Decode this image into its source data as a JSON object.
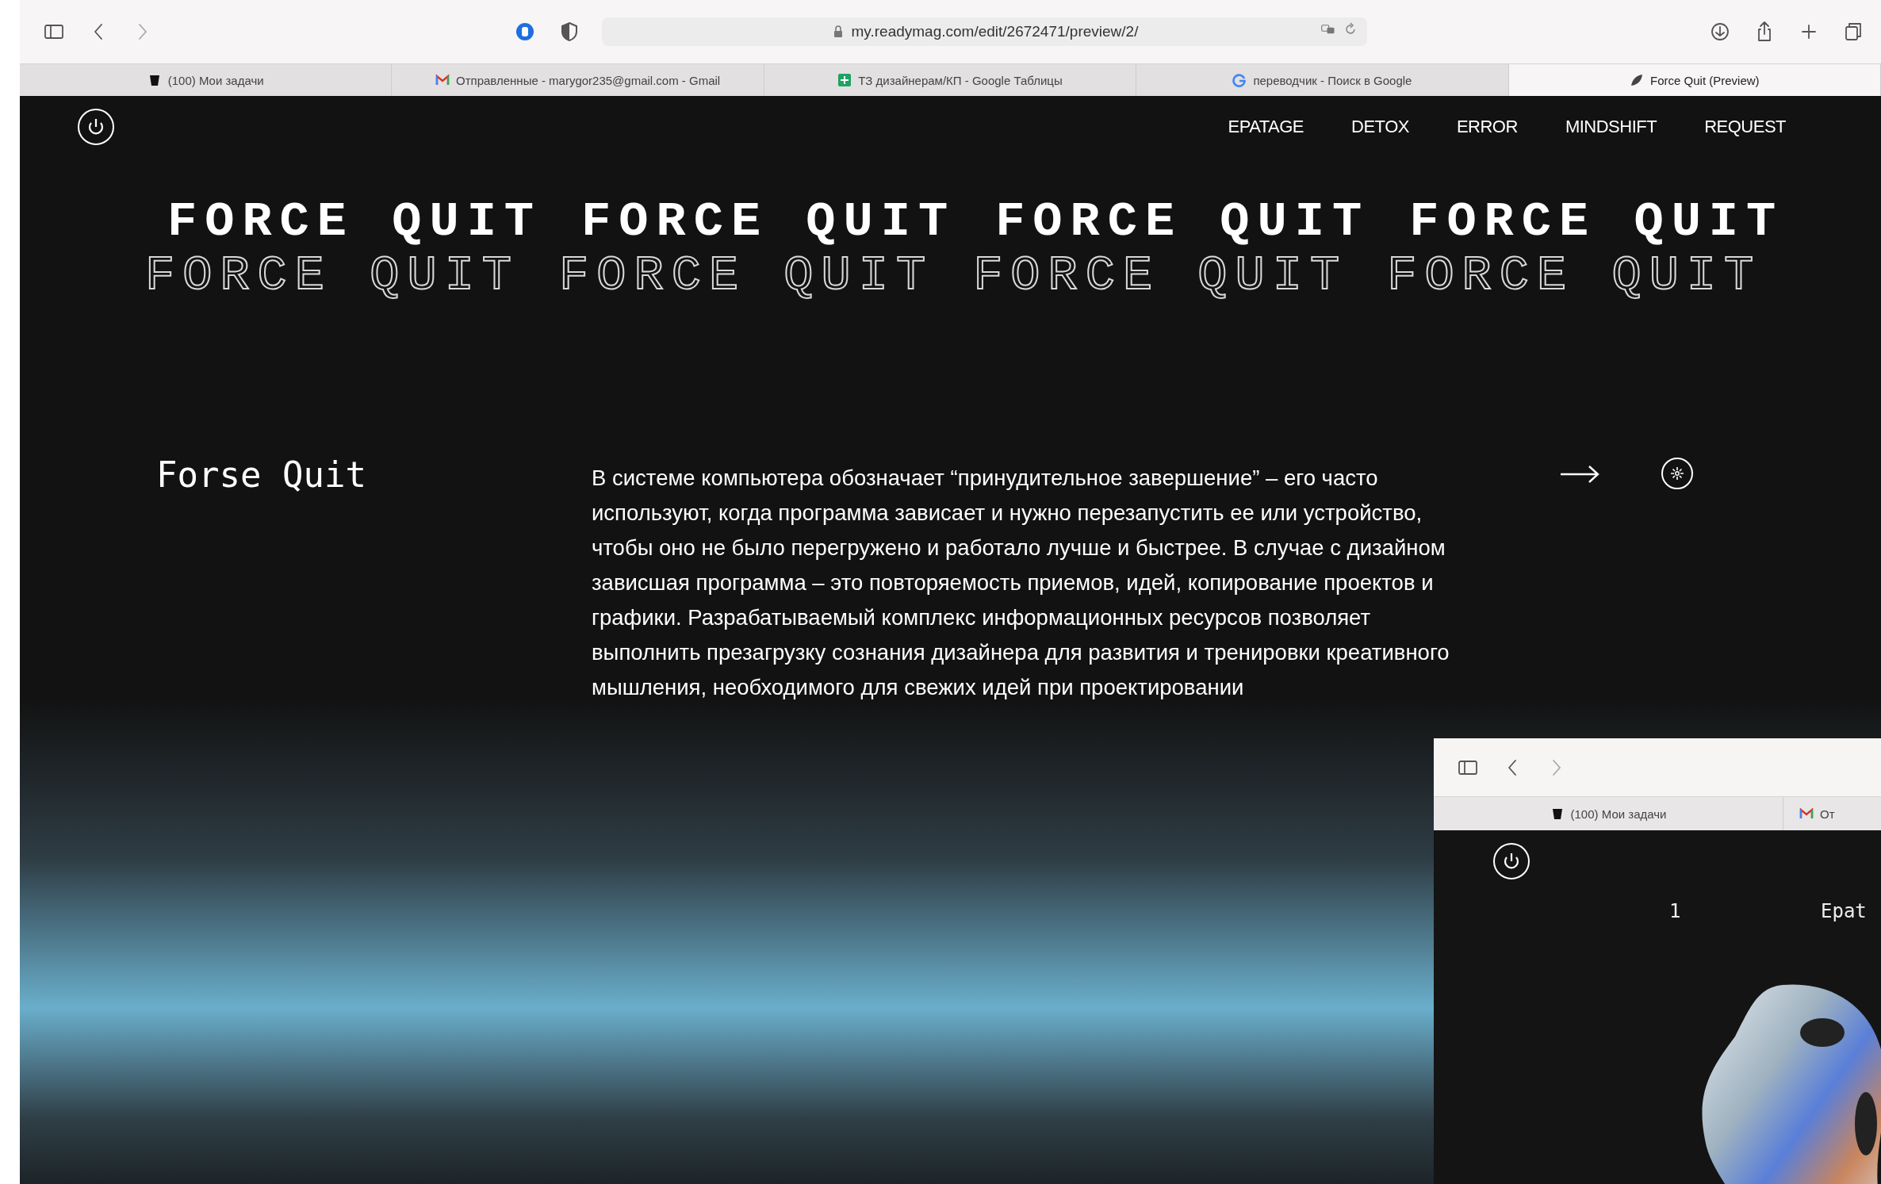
{
  "browser": {
    "url": "my.readymag.com/edit/2672471/preview/2/",
    "tabs": [
      {
        "title": "(100) Мои задачи",
        "kind": "cup",
        "selected": false
      },
      {
        "title": "Отправленные - marygor235@gmail.com - Gmail",
        "kind": "mail",
        "selected": false
      },
      {
        "title": "ТЗ дизайнерам/КП - Google Таблицы",
        "kind": "sheet",
        "selected": false
      },
      {
        "title": "переводчик - Поиск в Google",
        "kind": "search",
        "selected": false
      },
      {
        "title": "Force Quit (Preview)",
        "kind": "leaf",
        "selected": true
      }
    ]
  },
  "nav": {
    "items": [
      "EPATAGE",
      "DETOX",
      "ERROR",
      "MINDSHIFT",
      "REQUEST"
    ]
  },
  "marquee": [
    {
      "kind": "solid",
      "words": [
        "FORCE QUIT",
        "FORCE QUIT",
        "FORCE QUIT",
        "FORCE QUIT"
      ]
    },
    {
      "kind": "outline",
      "words": [
        "FORCE QUIT",
        "FORCE QUIT",
        "FORCE QUIT",
        "FORCE QUIT"
      ]
    }
  ],
  "section": {
    "heading": "Forse Quit",
    "paragraph": "В системе компьютера обозначает “принудительное завершение” – его часто используют, когда программа зависает и нужно перезапустить ее или устройство, чтобы оно не было перегружено и работало лучше и быстрее. В случае с дизайном зависшая программа – это повторяемость приемов, идей, копирование проектов и графики. Разрабатываемый комплекс информационных ресурсов позволяет выполнить презагрузку сознания дизайнера для развития и тренировки креативного мышления, необходимого для свежих идей при проектировании"
  },
  "inset": {
    "tabs": [
      {
        "title": "(100) Мои задачи",
        "kind": "cup"
      },
      {
        "title": "От",
        "kind": "mail"
      }
    ],
    "number": "1",
    "label": "Epat"
  }
}
